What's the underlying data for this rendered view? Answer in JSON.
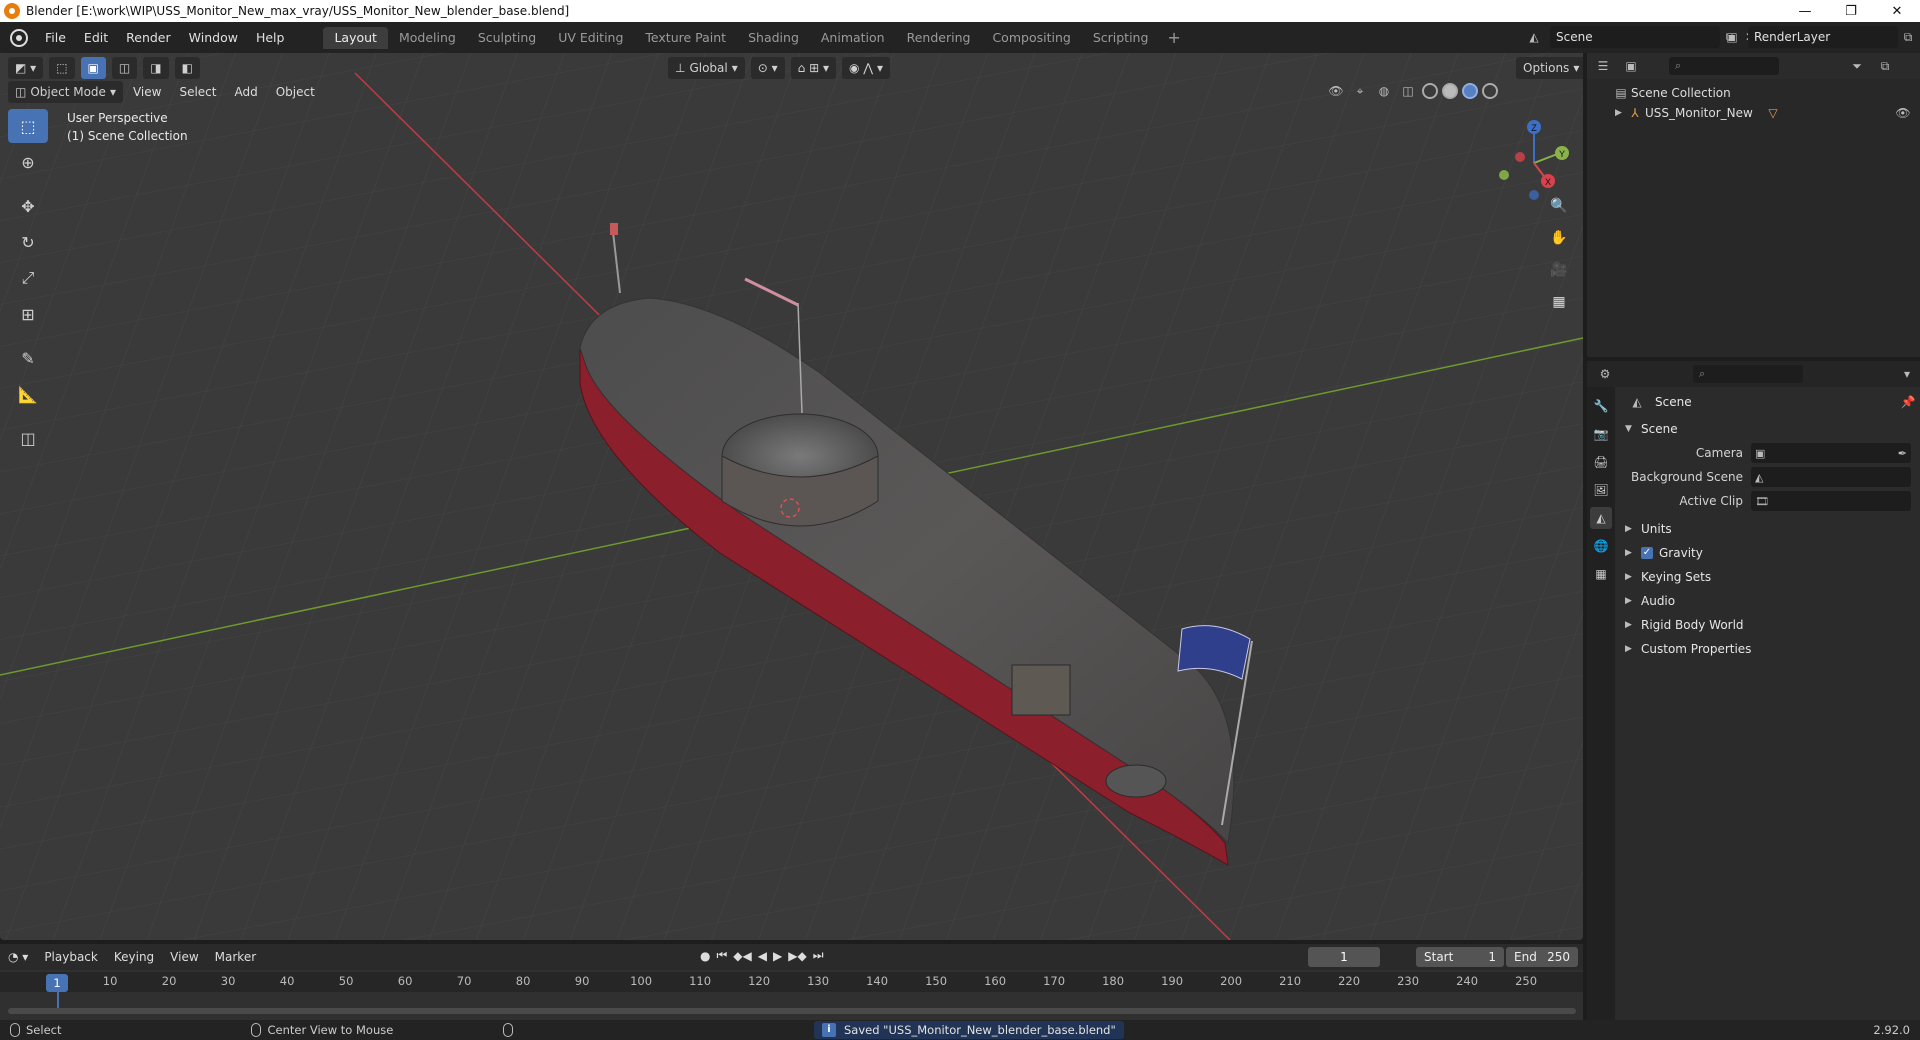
{
  "window": {
    "title": "Blender [E:\\work\\WIP\\USS_Monitor_New_max_vray/USS_Monitor_New_blender_base.blend]",
    "minimize": "—",
    "maximize": "❐",
    "close": "✕"
  },
  "menu": {
    "items": [
      "File",
      "Edit",
      "Render",
      "Window",
      "Help"
    ]
  },
  "workspaces": {
    "tabs": [
      "Layout",
      "Modeling",
      "Sculpting",
      "UV Editing",
      "Texture Paint",
      "Shading",
      "Animation",
      "Rendering",
      "Compositing",
      "Scripting"
    ],
    "active": "Layout",
    "add": "+"
  },
  "scene_selector": {
    "value": "Scene"
  },
  "renderlayer_selector": {
    "value": "RenderLayer"
  },
  "viewport": {
    "mode": "Object Mode",
    "menus": [
      "View",
      "Select",
      "Add",
      "Object"
    ],
    "orientation": "Global",
    "options": "Options",
    "overlay_line1": "User Perspective",
    "overlay_line2": "(1) Scene Collection",
    "gizmo": {
      "x": "X",
      "y": "Y",
      "z": "Z"
    }
  },
  "timeline": {
    "menus": [
      "Playback",
      "Keying",
      "View",
      "Marker"
    ],
    "current_frame": "1",
    "start_label": "Start",
    "start_value": "1",
    "end_label": "End",
    "end_value": "250",
    "ticks": [
      "1",
      "10",
      "20",
      "30",
      "40",
      "50",
      "60",
      "70",
      "80",
      "90",
      "100",
      "110",
      "120",
      "130",
      "140",
      "150",
      "160",
      "170",
      "180",
      "190",
      "200",
      "210",
      "220",
      "230",
      "240",
      "250"
    ]
  },
  "outliner": {
    "collection": "Scene Collection",
    "object": "USS_Monitor_New"
  },
  "properties": {
    "title": "Scene",
    "section": "Scene",
    "fields": [
      {
        "label": "Camera"
      },
      {
        "label": "Background Scene"
      },
      {
        "label": "Active Clip"
      }
    ],
    "panels": [
      "Units",
      "Gravity",
      "Keying Sets",
      "Audio",
      "Rigid Body World",
      "Custom Properties"
    ]
  },
  "statusbar": {
    "select": "Select",
    "center_view": "Center View to Mouse",
    "saved": "Saved \"USS_Monitor_New_blender_base.blend\"",
    "version": "2.92.0"
  },
  "colors": {
    "accent": "#4772b3",
    "hull_red": "#8c1f2c",
    "x_axis": "#c23b45",
    "y_axis": "#6d9a2e"
  }
}
